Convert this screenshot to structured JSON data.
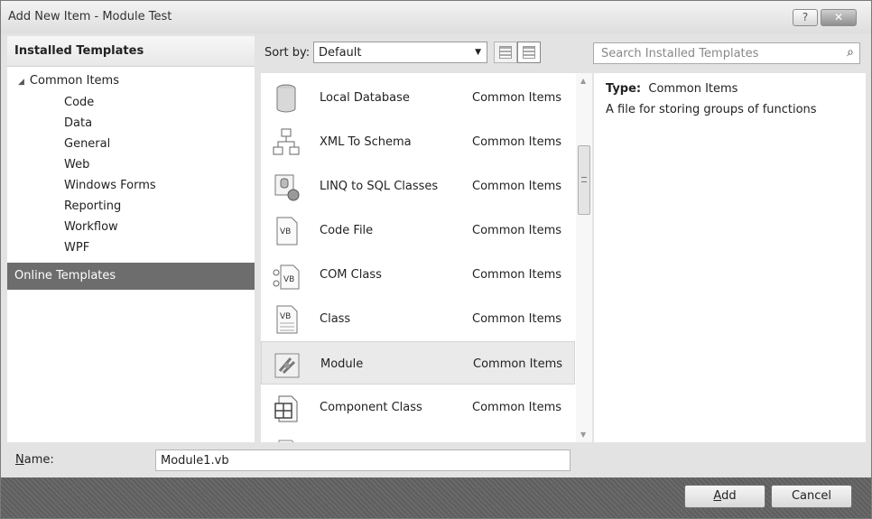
{
  "window": {
    "title": "Add New Item - Module Test",
    "help_label": "?",
    "close_label": "✕"
  },
  "left": {
    "header": "Installed Templates",
    "root": "Common Items",
    "children": [
      "Code",
      "Data",
      "General",
      "Web",
      "Windows Forms",
      "Reporting",
      "Workflow",
      "WPF"
    ],
    "online": "Online Templates"
  },
  "sort": {
    "label": "Sort by:",
    "value": "Default"
  },
  "search": {
    "placeholder": "Search Installed Templates"
  },
  "items": [
    {
      "name": "Local Database",
      "category": "Common Items",
      "icon": "database-icon"
    },
    {
      "name": "XML To Schema",
      "category": "Common Items",
      "icon": "xml-schema-icon"
    },
    {
      "name": "LINQ to SQL Classes",
      "category": "Common Items",
      "icon": "linq-icon"
    },
    {
      "name": "Code File",
      "category": "Common Items",
      "icon": "code-file-icon"
    },
    {
      "name": "COM Class",
      "category": "Common Items",
      "icon": "com-class-icon"
    },
    {
      "name": "Class",
      "category": "Common Items",
      "icon": "class-icon"
    },
    {
      "name": "Module",
      "category": "Common Items",
      "icon": "module-icon",
      "selected": true
    },
    {
      "name": "Component Class",
      "category": "Common Items",
      "icon": "component-class-icon"
    }
  ],
  "details": {
    "type_label": "Type:",
    "type_value": "Common Items",
    "description": "A file for storing groups of functions"
  },
  "name_field": {
    "label_accel": "N",
    "label_rest": "ame:",
    "value": "Module1.vb"
  },
  "buttons": {
    "add_accel": "A",
    "add_rest": "dd",
    "cancel": "Cancel"
  }
}
